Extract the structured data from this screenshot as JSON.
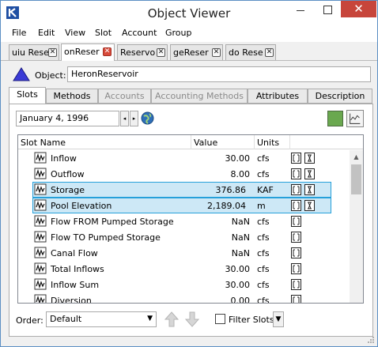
{
  "window": {
    "title": "Object Viewer",
    "close_glyph": "✕",
    "close_color": "#c7453b"
  },
  "menu": [
    "File",
    "Edit",
    "View",
    "Slot",
    "Account",
    "Group"
  ],
  "doc_tabs": [
    {
      "label": "uiu Rese",
      "active": false
    },
    {
      "label": "onReser",
      "active": true
    },
    {
      "label": "Reservo",
      "active": false
    },
    {
      "label": "geReser",
      "active": false
    },
    {
      "label": "do Rese",
      "active": false
    }
  ],
  "object": {
    "label": "Object:",
    "value": "HeronReservoir",
    "icon": "reservoir-triangle-icon",
    "icon_color": "#3b3bd6"
  },
  "prop_tabs": [
    {
      "label": "Slots",
      "active": true,
      "enabled": true
    },
    {
      "label": "Methods",
      "active": false,
      "enabled": true
    },
    {
      "label": "Accounts",
      "active": false,
      "enabled": false
    },
    {
      "label": "Accounting Methods",
      "active": false,
      "enabled": false
    },
    {
      "label": "Attributes",
      "active": false,
      "enabled": true
    },
    {
      "label": "Description",
      "active": false,
      "enabled": true
    }
  ],
  "date": {
    "value": "January 4, 1996",
    "prev_glyph": "◂",
    "next_glyph": "▸"
  },
  "table": {
    "headers": {
      "name": "Slot Name",
      "value": "Value",
      "units": "Units"
    },
    "rows": [
      {
        "name": "Inflow",
        "value": "30.00",
        "units": "cfs",
        "flags": 2,
        "selected": false
      },
      {
        "name": "Outflow",
        "value": "8.00",
        "units": "cfs",
        "flags": 2,
        "selected": false
      },
      {
        "name": "Storage",
        "value": "376.86",
        "units": "KAF",
        "flags": 2,
        "selected": true
      },
      {
        "name": "Pool Elevation",
        "value": "2,189.04",
        "units": "m",
        "flags": 2,
        "selected": true
      },
      {
        "name": "Flow FROM Pumped Storage",
        "value": "NaN",
        "units": "cfs",
        "flags": 1,
        "selected": false
      },
      {
        "name": "Flow TO Pumped Storage",
        "value": "NaN",
        "units": "cfs",
        "flags": 1,
        "selected": false
      },
      {
        "name": "Canal Flow",
        "value": "NaN",
        "units": "cfs",
        "flags": 1,
        "selected": false
      },
      {
        "name": "Total Inflows",
        "value": "30.00",
        "units": "cfs",
        "flags": 1,
        "selected": false
      },
      {
        "name": "Inflow Sum",
        "value": "30.00",
        "units": "cfs",
        "flags": 1,
        "selected": false
      },
      {
        "name": "Diversion",
        "value": "0.00",
        "units": "cfs",
        "flags": 1,
        "selected": false
      }
    ]
  },
  "bottom": {
    "order_label": "Order:",
    "order_value": "Default",
    "filter_label": "Filter Slots",
    "filter_checked": false
  },
  "colors": {
    "selection_bg": "#cde8f6",
    "selection_border": "#26a0da",
    "green_button": "#6aa84f"
  }
}
